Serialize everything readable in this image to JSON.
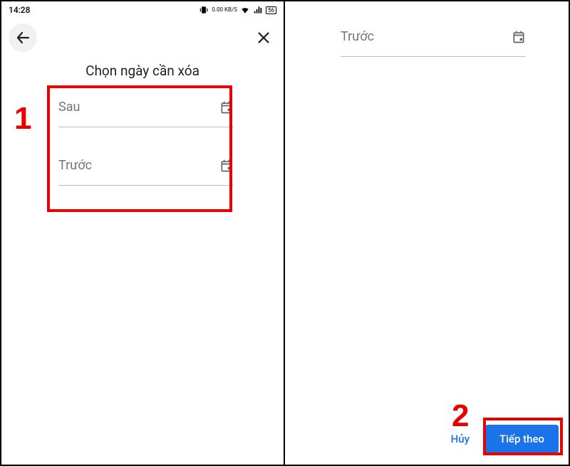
{
  "status": {
    "time": "14:28",
    "net_speed": "0.00 KB/S",
    "net_label": "56"
  },
  "left": {
    "title": "Chọn ngày cần xóa",
    "fields": {
      "after_label": "Sau",
      "before_label": "Trước"
    }
  },
  "right": {
    "before_label": "Trước",
    "cancel_label": "Hủy",
    "next_label": "Tiếp theo"
  },
  "annotations": {
    "one": "1",
    "two": "2"
  }
}
